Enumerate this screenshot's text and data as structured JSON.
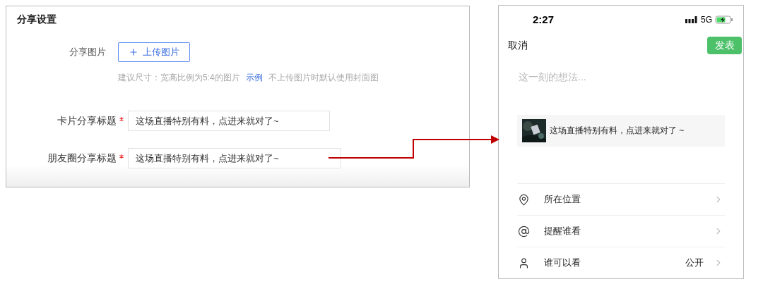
{
  "share_settings": {
    "title": "分享设置",
    "image_field": {
      "label": "分享图片",
      "button": "上传图片",
      "hint": "建议尺寸：宽高比例为5:4的图片",
      "example_link": "示例",
      "hint_tail": "不上传图片时默认使用封面图"
    },
    "fields": [
      {
        "label": "卡片分享标题",
        "required": true,
        "value": "这场直播特别有料，点进来就对了~"
      },
      {
        "label": "朋友圈分享标题",
        "required": true,
        "value": "这场直播特别有料，点进来就对了~"
      }
    ]
  },
  "phone": {
    "status_bar": {
      "time": "2:27",
      "network": "5G"
    },
    "cancel": "取消",
    "publish": "发表",
    "placeholder": "这一刻的想法...",
    "link_card": {
      "kind": "picture",
      "title": "这场直播特别有料，点进来就对了 ~"
    },
    "options": [
      {
        "kind": "location",
        "label": "所在位置"
      },
      {
        "kind": "mention",
        "label": "提醒谁看"
      },
      {
        "kind": "visibility",
        "label": "谁可以看",
        "value": "公开"
      }
    ]
  }
}
